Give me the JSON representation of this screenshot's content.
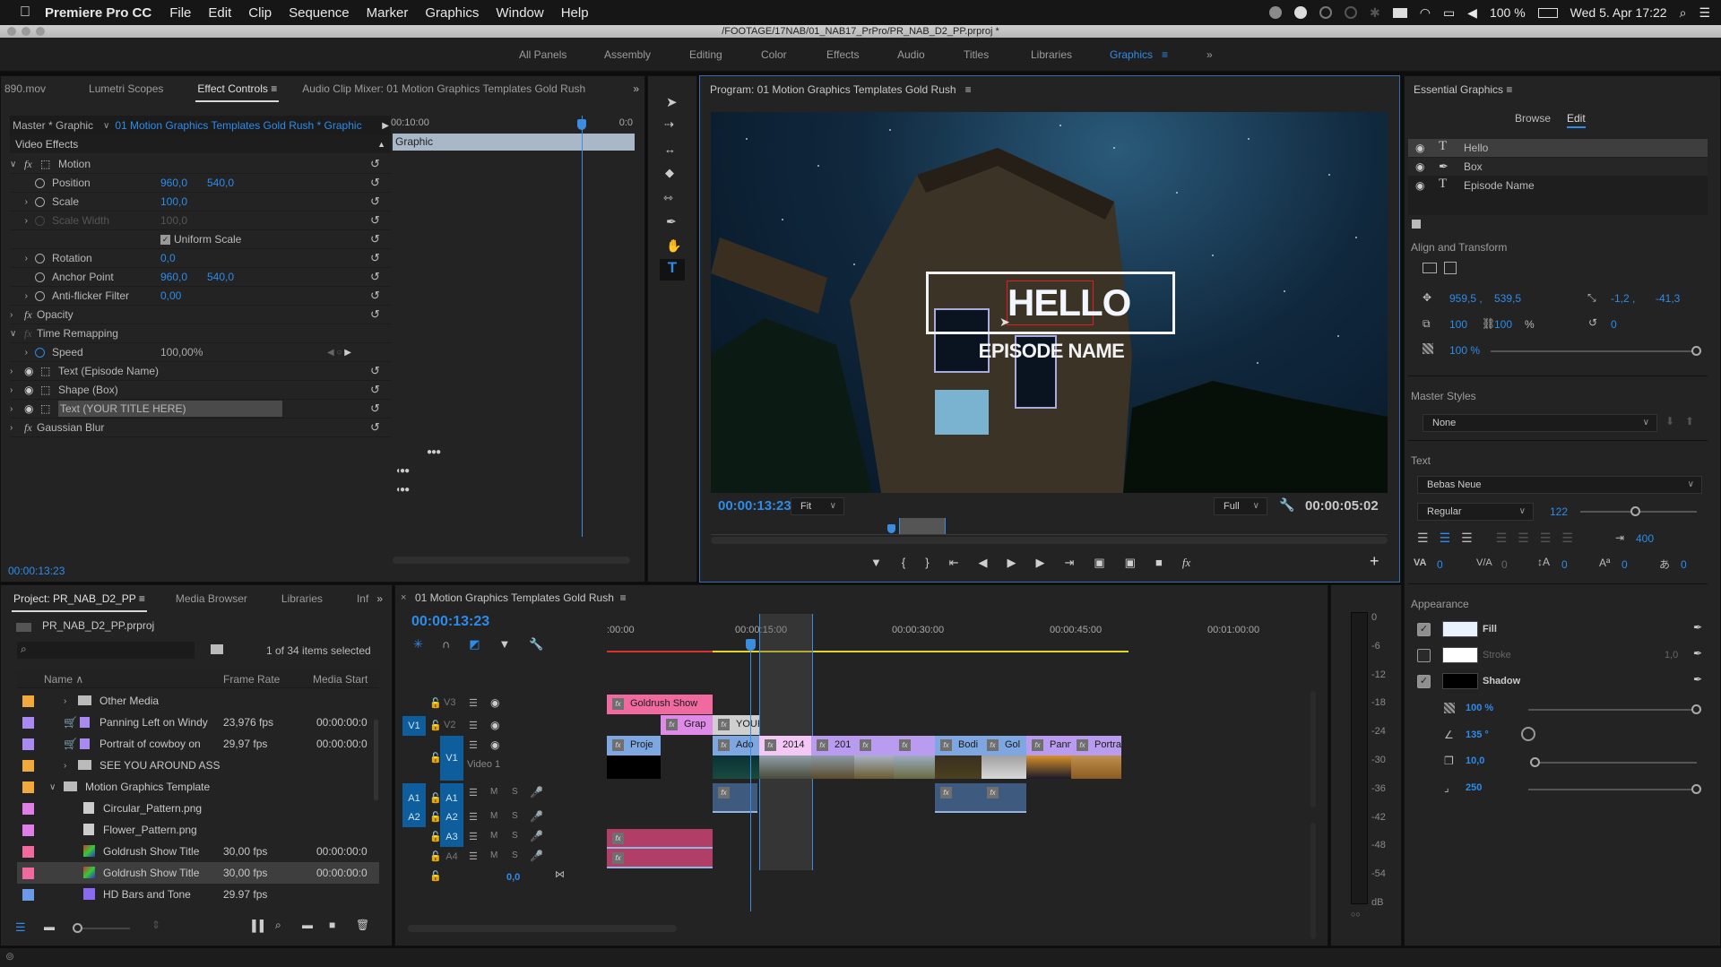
{
  "menubar": {
    "app_name": "Premiere Pro CC",
    "items": [
      "File",
      "Edit",
      "Clip",
      "Sequence",
      "Marker",
      "Graphics",
      "Window",
      "Help"
    ],
    "battery": "100 %",
    "datetime": "Wed 5. Apr  17:22"
  },
  "window": {
    "title": "/FOOTAGE/17NAB/01_NAB17_PrPro/PR_NAB_D2_PP.prproj *"
  },
  "workspaces": {
    "items": [
      "All Panels",
      "Assembly",
      "Editing",
      "Color",
      "Effects",
      "Audio",
      "Titles",
      "Libraries",
      "Graphics"
    ],
    "active": "Graphics",
    "overflow": "»"
  },
  "effect_controls": {
    "tabs": [
      "890.mov",
      "Lumetri Scopes",
      "Effect Controls",
      "Audio Clip Mixer: 01 Motion Graphics Templates Gold Rush"
    ],
    "active_tab": "Effect Controls",
    "master_label": "Master * Graphic",
    "clip_label": "01 Motion Graphics Templates Gold Rush * Graphic",
    "ruler_start": "00:10:00",
    "ruler_end": "0:0",
    "clip_bar_label": "Graphic",
    "section": "Video Effects",
    "rows": [
      {
        "label": "Motion",
        "type": "effect"
      },
      {
        "label": "Position",
        "v1": "960,0",
        "v2": "540,0"
      },
      {
        "label": "Scale",
        "v1": "100,0"
      },
      {
        "label": "Scale Width",
        "v1": "100,0",
        "disabled": true
      },
      {
        "label": "Uniform Scale",
        "checked": true
      },
      {
        "label": "Rotation",
        "v1": "0,0"
      },
      {
        "label": "Anchor Point",
        "v1": "960,0",
        "v2": "540,0"
      },
      {
        "label": "Anti-flicker Filter",
        "v1": "0,00"
      },
      {
        "label": "Opacity",
        "type": "effect"
      },
      {
        "label": "Time Remapping",
        "type": "effect"
      },
      {
        "label": "Speed",
        "v1": "100,00%"
      },
      {
        "label": "Text (Episode Name)",
        "type": "layer"
      },
      {
        "label": "Shape (Box)",
        "type": "layer"
      },
      {
        "label": "Text (YOUR TITLE HERE)",
        "type": "layer",
        "selected": true
      },
      {
        "label": "Gaussian Blur",
        "type": "effect"
      }
    ],
    "timecode": "00:00:13:23"
  },
  "program": {
    "title": "Program: 01 Motion Graphics Templates Gold Rush",
    "overlay_title": "HELLO",
    "overlay_subtitle": "EPISODE NAME",
    "timecode": "00:00:13:23",
    "zoom": "Fit",
    "resolution": "Full",
    "duration": "00:00:05:02"
  },
  "essential_graphics": {
    "title": "Essential Graphics",
    "tabs": [
      "Browse",
      "Edit"
    ],
    "active_tab": "Edit",
    "layers": [
      {
        "name": "Hello",
        "icon": "text-icon",
        "selected": true
      },
      {
        "name": "Box",
        "icon": "pen-icon"
      },
      {
        "name": "Episode Name",
        "icon": "text-icon"
      }
    ],
    "align_transform": {
      "label": "Align and Transform",
      "pos_x": "959,5 ,",
      "pos_y": "539,5",
      "anchor_x": "-1,2 ,",
      "anchor_y": "-41,3",
      "scale": "100",
      "scale_h": "100",
      "scale_unit": "%",
      "rotation": "0",
      "opacity": "100 %",
      "opacity_value": 1.0
    },
    "master_styles": {
      "label": "Master Styles",
      "value": "None"
    },
    "text": {
      "label": "Text",
      "font": "Bebas Neue",
      "style": "Regular",
      "size": "122",
      "size_fraction": 0.45,
      "tab_width": "400",
      "kerning": "0",
      "tracking": "0",
      "leading": "0",
      "baseline": "0",
      "tsume": "0"
    },
    "appearance": {
      "label": "Appearance",
      "fill": {
        "label": "Fill",
        "checked": true,
        "color": "#e8f2ff"
      },
      "stroke": {
        "label": "Stroke",
        "checked": false,
        "color": "#ffffff",
        "width": "1,0"
      },
      "shadow": {
        "label": "Shadow",
        "checked": true,
        "color": "#000000"
      },
      "shadow_opacity": "100 %",
      "shadow_angle": "135 °",
      "shadow_distance": "10,0",
      "shadow_size": "250"
    }
  },
  "project": {
    "tabs": [
      "Project: PR_NAB_D2_PP",
      "Media Browser",
      "Libraries",
      "Inf"
    ],
    "active_tab": "Project: PR_NAB_D2_PP",
    "file": "PR_NAB_D2_PP.prproj",
    "search_placeholder": "",
    "selection_status": "1 of 34 items selected",
    "columns": [
      "Name",
      "Frame Rate",
      "Media Start"
    ],
    "rows": [
      {
        "name": "Other Media",
        "type": "folder",
        "color": "#f2a93b",
        "fps": "",
        "start": "",
        "indent": 1
      },
      {
        "name": "Panning Left on Windy",
        "type": "clip",
        "color": "#a88af0",
        "fps": "23,976 fps",
        "start": "00:00:00:0",
        "indent": 1
      },
      {
        "name": "Portrait of cowboy on",
        "type": "clip",
        "color": "#a88af0",
        "fps": "29,97 fps",
        "start": "00:00:00:0",
        "indent": 1
      },
      {
        "name": "SEE YOU AROUND ASS",
        "type": "folder",
        "color": "#f2a93b",
        "fps": "",
        "start": "",
        "indent": 1
      },
      {
        "name": "Motion Graphics Template",
        "type": "folder-open",
        "color": "#f2a93b",
        "fps": "",
        "start": "",
        "indent": 0
      },
      {
        "name": "Circular_Pattern.png",
        "type": "image",
        "color": "#e07ee8",
        "fps": "",
        "start": "",
        "indent": 2
      },
      {
        "name": "Flower_Pattern.png",
        "type": "image",
        "color": "#e07ee8",
        "fps": "",
        "start": "",
        "indent": 2
      },
      {
        "name": "Goldrush Show Title",
        "type": "graphic",
        "color": "#f06aa0",
        "fps": "30,00 fps",
        "start": "00:00:00:0",
        "indent": 2
      },
      {
        "name": "Goldrush Show Title",
        "type": "graphic",
        "color": "#f06aa0",
        "fps": "30,00 fps",
        "start": "00:00:00:0",
        "indent": 2,
        "selected": true
      },
      {
        "name": "HD Bars and Tone",
        "type": "bars",
        "color": "#6b9ae8",
        "fps": "29.97 fps",
        "start": "",
        "indent": 2
      }
    ]
  },
  "timeline": {
    "title": "01 Motion Graphics Templates Gold Rush",
    "timecode": "00:00:13:23",
    "ruler": [
      ":00:00",
      "00:00:15:00",
      "00:00:30:00",
      "00:00:45:00",
      "00:01:00:00"
    ],
    "video_tracks": [
      {
        "name": "V3",
        "source": ""
      },
      {
        "name": "V2",
        "source": "V1"
      },
      {
        "name": "V1",
        "source": "",
        "label": "Video 1"
      }
    ],
    "audio_tracks": [
      {
        "name": "A1",
        "source": "A1"
      },
      {
        "name": "A2",
        "source": "A2"
      },
      {
        "name": "A3",
        "source": ""
      },
      {
        "name": "A4",
        "source": ""
      }
    ],
    "master_volume": "0,0",
    "clips": {
      "v3": [
        {
          "label": "Goldrush Show",
          "color": "#f06aa0"
        }
      ],
      "v2": [
        {
          "label": "Grap",
          "color": "#e08ae8"
        },
        {
          "label": "YOUR",
          "color": "#cfcfcf"
        }
      ],
      "v1": [
        {
          "label": "Proje",
          "color": "#7ea6e0"
        },
        {
          "label": "Ado",
          "color": "#7ea6e0"
        },
        {
          "label": "2014",
          "color": "#f3c8f5"
        },
        {
          "label": "201",
          "color": "#b99cf0"
        },
        {
          "label": "",
          "color": "#b99cf0"
        },
        {
          "label": "",
          "color": "#b99cf0"
        },
        {
          "label": "Bodi",
          "color": "#7ea6e0"
        },
        {
          "label": "Gol",
          "color": "#7ea6e0"
        },
        {
          "label": "Pann",
          "color": "#b99cf0"
        },
        {
          "label": "Portrait",
          "color": "#b99cf0"
        }
      ]
    }
  },
  "audio_meter": {
    "ticks": [
      "0",
      "-6",
      "-12",
      "-18",
      "-24",
      "-30",
      "-36",
      "-42",
      "-48",
      "-54",
      "dB"
    ]
  }
}
